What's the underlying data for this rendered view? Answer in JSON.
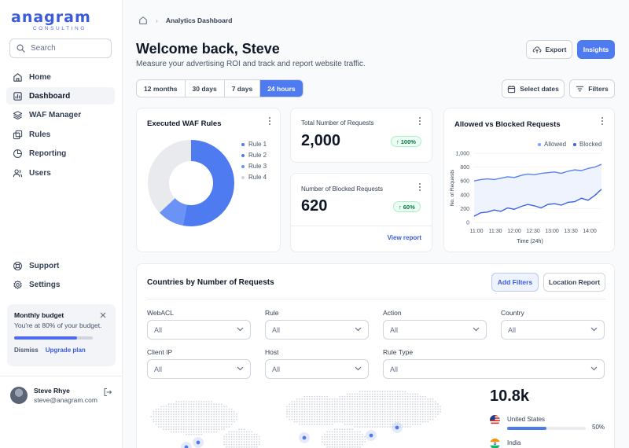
{
  "brand": {
    "name": "anagram",
    "tagline": "CONSULTING",
    "color": "#3b5bdb"
  },
  "search": {
    "placeholder": "Search"
  },
  "nav": [
    {
      "label": "Home",
      "icon": "home-icon",
      "active": false
    },
    {
      "label": "Dashboard",
      "icon": "dashboard-icon",
      "active": true
    },
    {
      "label": "WAF Manager",
      "icon": "layers-icon",
      "active": false
    },
    {
      "label": "Rules",
      "icon": "rules-icon",
      "active": false
    },
    {
      "label": "Reporting",
      "icon": "pie-chart-icon",
      "active": false
    },
    {
      "label": "Users",
      "icon": "users-icon",
      "active": false
    }
  ],
  "nav_bottom": [
    {
      "label": "Support",
      "icon": "support-icon"
    },
    {
      "label": "Settings",
      "icon": "gear-icon"
    }
  ],
  "budget": {
    "title": "Monthly budget",
    "desc": "You're at 80% of your budget.",
    "progress": 0.8,
    "dismiss": "Dismiss",
    "upgrade": "Upgrade plan"
  },
  "user": {
    "name": "Steve Rhye",
    "email": "steve@anagram.com"
  },
  "breadcrumb": {
    "current": "Analytics Dashboard"
  },
  "header": {
    "title": "Welcome back, Steve",
    "subtitle": "Measure your advertising ROI and track and report website traffic.",
    "export": "Export",
    "insights": "Insights"
  },
  "range_tabs": [
    {
      "label": "12 months",
      "active": false
    },
    {
      "label": "30 days",
      "active": false
    },
    {
      "label": "7 days",
      "active": false
    },
    {
      "label": "24 hours",
      "active": true
    }
  ],
  "select_dates": "Select dates",
  "filters": "Filters",
  "waf_card": {
    "title": "Executed WAF Rules",
    "legend": [
      "Rule 1",
      "Rule 2",
      "Rule 3",
      "Rule 4"
    ]
  },
  "total_card": {
    "label": "Total Number of Requests",
    "value": "2,000",
    "change": "100%"
  },
  "blocked_card": {
    "label": "Number of Blocked Requests",
    "value": "620",
    "change": "60%",
    "link": "View report"
  },
  "allowed_card": {
    "title": "Allowed vs Blocked Requests",
    "legend": [
      "Allowed",
      "Blocked"
    ],
    "ylabel": "No. of Requests",
    "xlabel": "Time (24h)",
    "yticks": [
      "1,000",
      "800",
      "600",
      "400",
      "200",
      "0"
    ],
    "xticks": [
      "11:00",
      "11:30",
      "12:00",
      "12:30",
      "13:00",
      "13:30",
      "14:00"
    ]
  },
  "countries_card": {
    "title": "Countries by Number of Requests",
    "add_filters": "Add Filters",
    "location_report": "Location Report",
    "filters": [
      {
        "label": "WebACL",
        "value": "All"
      },
      {
        "label": "Rule",
        "value": "All"
      },
      {
        "label": "Action",
        "value": "All"
      },
      {
        "label": "Country",
        "value": "All"
      },
      {
        "label": "Client IP",
        "value": "All"
      },
      {
        "label": "Host",
        "value": "All"
      },
      {
        "label": "Rule Type",
        "value": "All"
      }
    ],
    "total": "10.8k",
    "countries": [
      {
        "name": "United States",
        "pct": "50%",
        "fraction": 0.5
      },
      {
        "name": "India"
      }
    ]
  },
  "chart_data": [
    {
      "type": "pie",
      "title": "Executed WAF Rules",
      "categories": [
        "Rule 1",
        "Rule 2",
        "Rule 3",
        "Rule 4"
      ],
      "values": [
        25,
        28,
        10,
        37
      ],
      "colors": [
        "#4f7bf0",
        "#4f7bf0",
        "#6b93f5",
        "#e9eaee"
      ]
    },
    {
      "type": "line",
      "title": "Allowed vs Blocked Requests",
      "xlabel": "Time (24h)",
      "ylabel": "No. of Requests",
      "ylim": [
        0,
        1000
      ],
      "x": [
        "11:00",
        "11:10",
        "11:20",
        "11:30",
        "11:40",
        "11:50",
        "12:00",
        "12:10",
        "12:20",
        "12:30",
        "12:40",
        "12:50",
        "13:00",
        "13:10",
        "13:20",
        "13:30",
        "13:40",
        "13:50",
        "14:00",
        "14:10"
      ],
      "series": [
        {
          "name": "Allowed",
          "values": [
            600,
            620,
            630,
            620,
            640,
            660,
            650,
            680,
            700,
            690,
            710,
            720,
            730,
            710,
            740,
            760,
            750,
            780,
            800,
            840
          ]
        },
        {
          "name": "Blocked",
          "values": [
            90,
            140,
            150,
            180,
            160,
            210,
            190,
            230,
            260,
            240,
            210,
            260,
            270,
            250,
            290,
            300,
            350,
            320,
            390,
            480
          ]
        }
      ]
    }
  ]
}
